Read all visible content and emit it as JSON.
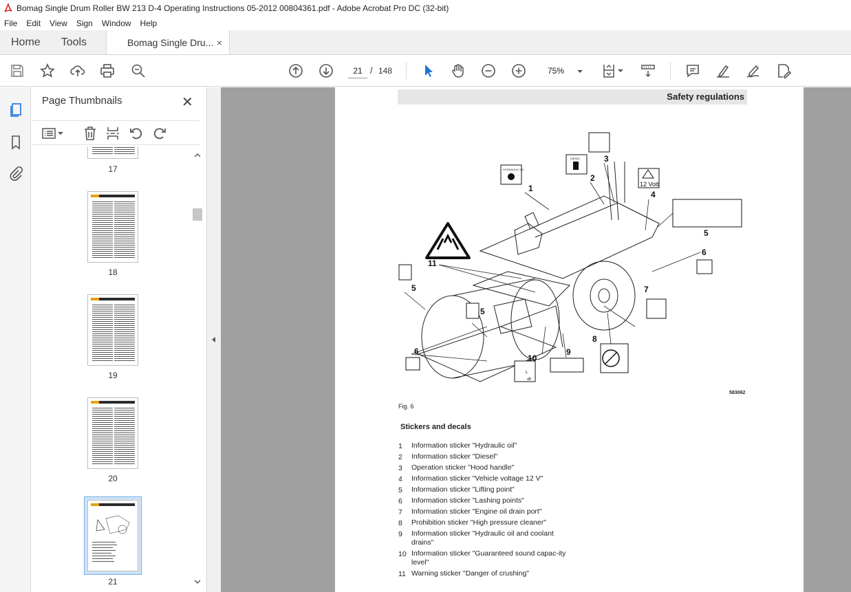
{
  "window": {
    "title": "Bomag Single Drum Roller BW 213 D-4 Operating Instructions 05-2012 00804361.pdf - Adobe Acrobat Pro DC (32-bit)"
  },
  "menu": [
    "File",
    "Edit",
    "View",
    "Sign",
    "Window",
    "Help"
  ],
  "tabs": {
    "home": "Home",
    "tools": "Tools",
    "document": "Bomag Single Dru...",
    "close": "×"
  },
  "toolbar": {
    "page_current": "21",
    "page_sep": "/",
    "page_total": "148",
    "zoom": "75%",
    "icons": [
      "save-icon",
      "bookmark-star-icon",
      "upload-icon",
      "print-icon",
      "find-icon",
      "page-up-icon",
      "page-down-icon",
      "select-cursor-icon",
      "hand-icon",
      "zoom-out-icon",
      "zoom-in-icon",
      "page-fit-icon",
      "scroll-mode-icon",
      "comment-icon",
      "highlight-icon",
      "sign-icon",
      "edit-pdf-icon"
    ]
  },
  "sidebar": {
    "title": "Page Thumbnails",
    "close": "✕",
    "thumbnails": [
      {
        "label": "17"
      },
      {
        "label": "18"
      },
      {
        "label": "19"
      },
      {
        "label": "20"
      },
      {
        "label": "21",
        "selected": true
      }
    ]
  },
  "document": {
    "header": "Safety regulations",
    "figure_caption": "Fig. 6",
    "figure_code": "583062",
    "figure_labels": [
      "1",
      "2",
      "3",
      "4",
      "5",
      "6",
      "7",
      "8",
      "9",
      "10",
      "11",
      "5",
      "5",
      "6",
      "6"
    ],
    "sticker_texts": {
      "voltage": "12 Volt",
      "diesel": "DIESEL",
      "hydraulic": "HYDRAULIC OIL",
      "sound": "L",
      "db": "dB"
    },
    "list_title": "Stickers and decals",
    "items": [
      {
        "n": "1",
        "text": "Information sticker \"Hydraulic oil\""
      },
      {
        "n": "2",
        "text": "Information sticker \"Diesel\""
      },
      {
        "n": "3",
        "text": "Operation sticker \"Hood handle\""
      },
      {
        "n": "4",
        "text": "Information sticker \"Vehicle voltage 12 V\""
      },
      {
        "n": "5",
        "text": "Information sticker \"Lifting point\""
      },
      {
        "n": "6",
        "text": "Information sticker \"Lashing points\""
      },
      {
        "n": "7",
        "text": "Information sticker \"Engine oil drain port\""
      },
      {
        "n": "8",
        "text": "Prohibition sticker \"High pressure cleaner\""
      },
      {
        "n": "9",
        "text": "Information sticker \"Hydraulic oil and coolant drains\""
      },
      {
        "n": "10",
        "text": "Information sticker \"Guaranteed sound capac-ity level\""
      },
      {
        "n": "11",
        "text": "Warning sticker \"Danger of crushing\""
      }
    ]
  },
  "colors": {
    "accent_blue": "#1a73d9",
    "pdf_red": "#d7261e",
    "doc_bg": "#a0a0a0"
  }
}
